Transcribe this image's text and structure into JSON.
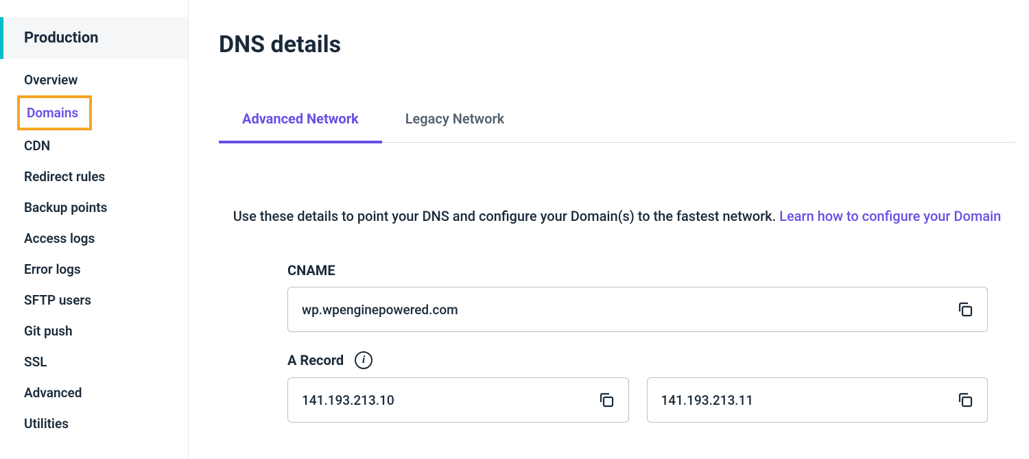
{
  "sidebar": {
    "section_label": "Production",
    "items": [
      {
        "label": "Overview"
      },
      {
        "label": "Domains"
      },
      {
        "label": "CDN"
      },
      {
        "label": "Redirect rules"
      },
      {
        "label": "Backup points"
      },
      {
        "label": "Access logs"
      },
      {
        "label": "Error logs"
      },
      {
        "label": "SFTP users"
      },
      {
        "label": "Git push"
      },
      {
        "label": "SSL"
      },
      {
        "label": "Advanced"
      },
      {
        "label": "Utilities"
      }
    ]
  },
  "page": {
    "title": "DNS details"
  },
  "tabs": {
    "advanced": "Advanced Network",
    "legacy": "Legacy Network"
  },
  "helper": {
    "text": "Use these details to point your DNS and configure your Domain(s) to the fastest network. ",
    "link_text": "Learn how to configure your Domain"
  },
  "dns": {
    "cname_label": "CNAME",
    "cname_value": "wp.wpenginepowered.com",
    "a_record_label": "A Record",
    "a_records": [
      "141.193.213.10",
      "141.193.213.11"
    ]
  }
}
